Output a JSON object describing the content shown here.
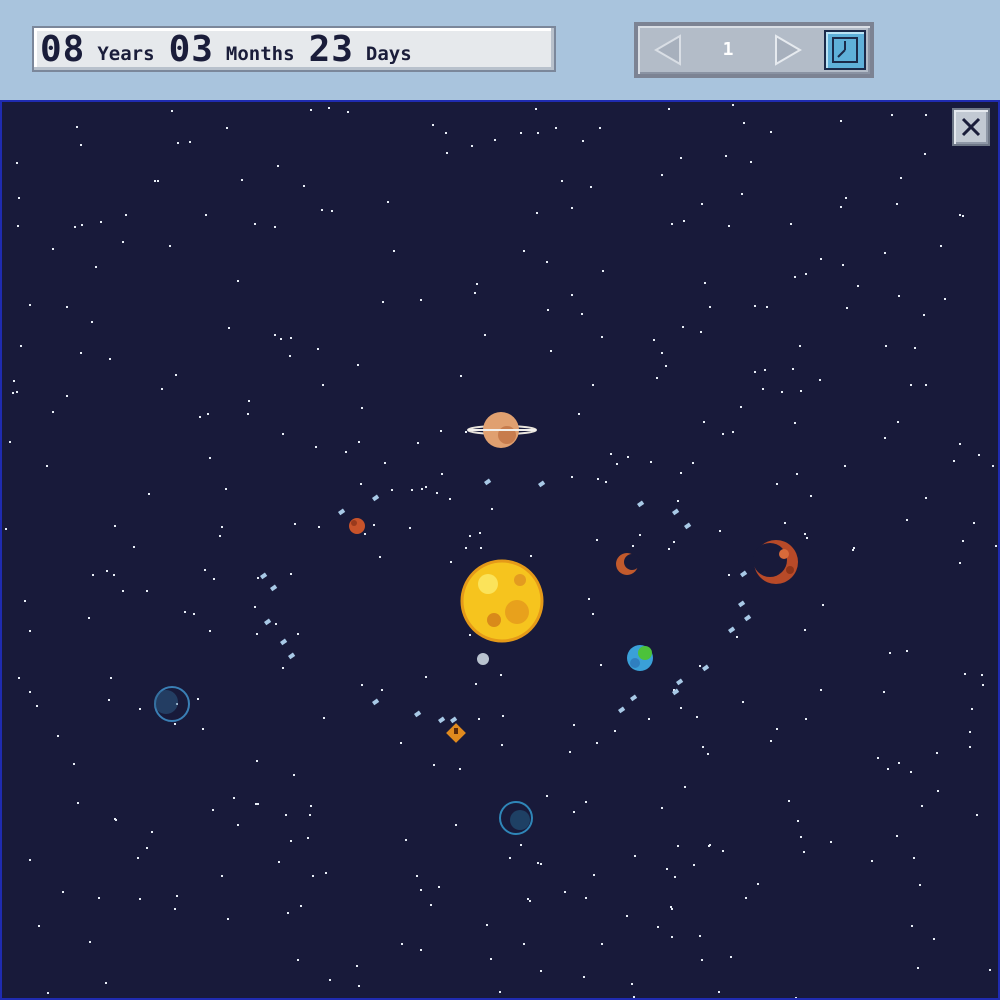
{
  "date": {
    "years": "08",
    "years_unit": "Years",
    "months": "03",
    "months_unit": "Months",
    "days": "23",
    "days_unit": "Days"
  },
  "controls": {
    "speed": "1",
    "prev_icon": "triangle-left-icon",
    "next_icon": "triangle-right-icon",
    "clock_icon": "clock-icon",
    "close_icon": "close-icon"
  },
  "colors": {
    "sky": "#a9c4dd",
    "space": "#181a3a",
    "sun": "#f6c41e",
    "earth": "#3aa0d8",
    "mars": "#c8532a",
    "saturn": "#e0a070"
  }
}
